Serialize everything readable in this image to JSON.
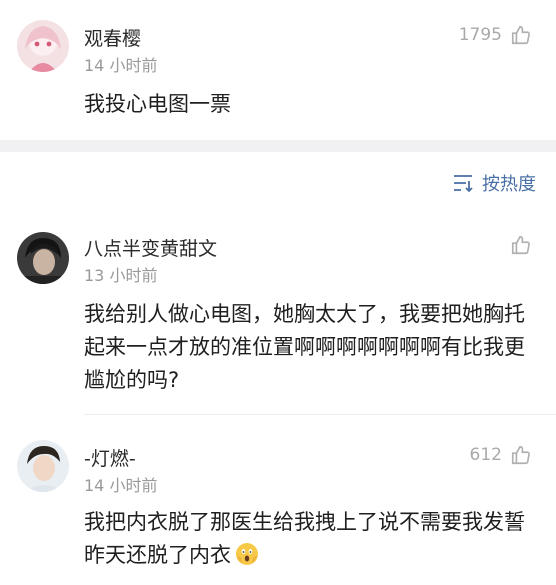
{
  "top_comment": {
    "username": "观春樱",
    "time": "14 小时前",
    "text": "我投心电图一票",
    "likes": "1795"
  },
  "sort": {
    "label": "按热度"
  },
  "comments": [
    {
      "username": "八点半变黄甜文",
      "time": "13 小时前",
      "text": "我给别人做心电图，她胸太大了，我要把她胸托起来一点才放的准位置啊啊啊啊啊啊啊有比我更尴尬的吗?",
      "likes": ""
    },
    {
      "username": "-灯燃-",
      "time": "14 小时前",
      "text": "我把内衣脱了那医生给我拽上了说不需要我发誓昨天还脱了内衣",
      "likes": "612"
    }
  ]
}
